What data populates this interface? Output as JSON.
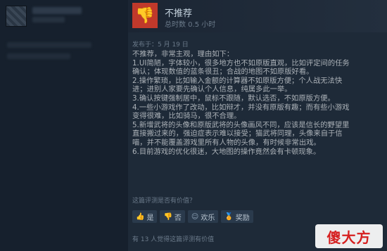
{
  "review": {
    "verdict": "不推荐",
    "hours": "总时数 0.5 小时",
    "posted": "发布于：5 月 19 日",
    "paragraphs": [
      "不推荐，非常主观，理由如下：",
      "1.UI简陋，字体较小，很多地方也不如原版直观，比如评定间的任务",
      "确认；体现数值的蓝条很丑；合战的地图不如原版好看。",
      "2.操作繁琐，比如输入金额的计算器不如原版方便；个人战无法快",
      "进；进别人家要先确认个人信息，纯属多此一举。",
      "3.确认按键强制居中，鼠标不跟随，默认选否，不如原版方便。",
      "4.一些小游戏作了改动，比如辩才，并没有原版有趣；而有些小游戏",
      "变得很难，比如骑马，很不合理。",
      "5.新增武将的头像和原版武将的头像画风不同，应该是信长的野望里",
      "直接搬过来的，强迫症表示难以接受；猫武将同理，头像来自于信",
      "喵，并不能覆盖游戏里所有人物的头像，有时候非常出戏。",
      "6.目前游戏的优化很迷，大地图的操作竟然会有卡顿现象。"
    ],
    "helpful_question": "这篇评测是否有价值？",
    "vote_buttons": {
      "yes": "是",
      "no": "否",
      "funny": "欢乐",
      "award": "奖励"
    },
    "helpful_count": "有 13 人觉得这篇评测有价值"
  },
  "watermark": "傻大方",
  "colors": {
    "background": "#1b2838",
    "thumb_down": "#c0392b",
    "watermark": "#d62020"
  }
}
